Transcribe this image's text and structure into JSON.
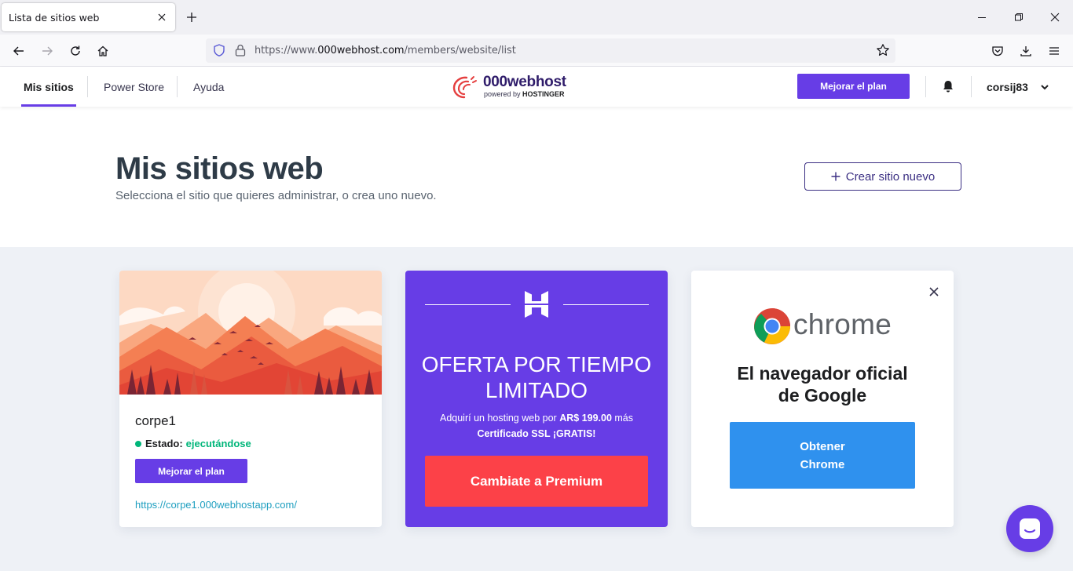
{
  "browser": {
    "tab_title": "Lista de sitios web",
    "url_prefix": "https://www.",
    "url_host": "000webhost.com",
    "url_path": "/members/website/list"
  },
  "header": {
    "nav": [
      "Mis sitios",
      "Power Store",
      "Ayuda"
    ],
    "logo_name": "000webhost",
    "logo_powered": "powered by",
    "logo_brand": "HOSTINGER",
    "upgrade_label": "Mejorar el plan",
    "username": "corsij83"
  },
  "hero": {
    "title": "Mis sitios web",
    "subtitle": "Selecciona el sitio que quieres administrar, o crea uno nuevo.",
    "create_label": "Crear sitio nuevo"
  },
  "site_card": {
    "name": "corpe1",
    "status_label": "Estado:",
    "status_value": "ejecutándose",
    "upgrade_label": "Mejorar el plan",
    "url": "https://corpe1.000webhostapp.com/"
  },
  "offer_card": {
    "title_line1": "OFERTA POR TIEMPO",
    "title_line2": "LIMITADO",
    "text_pre": "Adquirí un hosting web por",
    "price": "AR$ 199.00",
    "text_post": "más",
    "ssl": "Certificado SSL ¡GRATIS!",
    "cta": "Cambiate a Premium"
  },
  "chrome_card": {
    "brand": "chrome",
    "headline_line1": "El navegador oficial",
    "headline_line2": "de Google",
    "cta": "Obtener Chrome"
  },
  "colors": {
    "brand_purple": "#673de6",
    "premium_red": "#fc4148",
    "chrome_blue": "#2f91ee",
    "status_green": "#00b67a"
  }
}
